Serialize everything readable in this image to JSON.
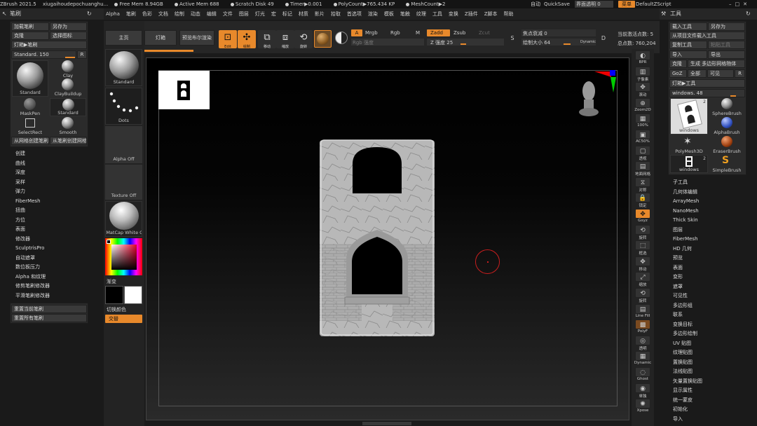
{
  "titlebar": {
    "app": "ZBrush 2021.5",
    "project": "xiugaihoudepochuanghu...",
    "stats": [
      "Free Mem 8.94GB",
      "Active Mem 688",
      "Scratch Disk 49",
      "Timer▶0.001",
      "PolyCount▶765.434 KP",
      "MeshCount▶2"
    ],
    "auto": "自动",
    "quicksave": "QuickSave",
    "transparency": "界面透明 0",
    "menu_btn": "菜单",
    "script": "DefaultZScript"
  },
  "menubar": [
    "Alpha",
    "笔刷",
    "色彩",
    "文档",
    "绘制",
    "动态",
    "编辑",
    "文件",
    "图层",
    "灯光",
    "宏",
    "标记",
    "材质",
    "影片",
    "拾取",
    "首选项",
    "渲染",
    "模板",
    "笔触",
    "纹理",
    "工具",
    "变换",
    "Z插件",
    "Z脚本",
    "帮助"
  ],
  "left": {
    "title": "笔刷",
    "buttons": [
      "加载笔刷",
      "另存为",
      "克隆",
      "选择图标"
    ],
    "lightbox": "灯箱▶笔刷",
    "standard_slider": "Standard. 150",
    "r": "R",
    "brushes": [
      "Standard",
      "Clay",
      "ClayBuildup",
      "MaskPen",
      "Standard",
      "SelectRect",
      "Smooth"
    ],
    "create_from_brush": "从网格创建笔刷",
    "create_from_stroke": "从笔刷创建网格",
    "menu": [
      "创建",
      "曲线",
      "深度",
      "采样",
      "弹力",
      "FiberMesh",
      "扭曲",
      "方位",
      "表面",
      "修改器",
      "SculptrisPro",
      "自动遮罩",
      "数位板压力",
      "Alpha 和纹理",
      "修剪笔刷修改器",
      "平滑笔刷修改器"
    ],
    "reset_current": "重置当前笔刷",
    "reset_all": "重置所有笔刷"
  },
  "shelf": {
    "standard": "Standard",
    "dots": "Dots",
    "alpha_off": "Alpha Off",
    "texture_off": "Texture Off",
    "matcap": "MatCap White C",
    "gradient": "渐变",
    "switch_color": "切换颜色",
    "alternate": "交替"
  },
  "top": {
    "home": "主页",
    "lightbox": "灯箱",
    "preview": "预览布尔渲染",
    "tools": [
      "Edit",
      "绘制",
      "移动",
      "缩放",
      "旋转"
    ],
    "a": "A",
    "mrgb": "Mrgb",
    "rgb": "Rgb",
    "m": "M",
    "zadd": "Zadd",
    "zsub": "Zsub",
    "zcut": "Zcut",
    "rgb_intensity": "Rgb 强度",
    "z_intensity": "Z 强度 25",
    "focal": "焦点衰减 0",
    "draw_size": "绘制大小 64",
    "dynamic": "Dynamic",
    "active_points": "当前激活点数: 5",
    "total_points": "总点数: 760,204"
  },
  "right_toolbar": [
    "BPR",
    "子像素",
    "滚动",
    "Zoom2D",
    "100%",
    "AC50%",
    "透视",
    "地面网格",
    "对称",
    "锁定",
    "Gxyz",
    "旋转",
    "框选",
    "移动",
    "缩放",
    "旋转",
    "Line Fill",
    "PolyF",
    "透明",
    "Dynamic",
    "Ghost",
    "单独",
    "Xpose"
  ],
  "tool": {
    "title": "工具",
    "load": "载入工具",
    "save_as": "另存为",
    "load_from_project": "从项目文件载入工具",
    "copy": "复制工具",
    "paste": "粘贴工具",
    "import": "导入",
    "export": "导出",
    "clone": "克隆",
    "make_polymesh": "生成 多边形网格物体",
    "goz": "GoZ",
    "all": "全部",
    "visible": "可见",
    "r": "R",
    "lightbox": "灯箱▶工具",
    "windows_slider": "windows. 48",
    "thumbs": [
      "windows",
      "SphereBrush",
      "AlphaBrush",
      "PolyMesh3D",
      "EraserBrush",
      "windows",
      "SimpleBrush"
    ],
    "count1": "2",
    "count2": "2",
    "menu": [
      "子工具",
      "几何体编辑",
      "ArrayMesh",
      "NanoMesh",
      "Thick Skin",
      "图层",
      "FiberMesh",
      "HD 几何",
      "预览",
      "表面",
      "变形",
      "遮罩",
      "可见性",
      "多边形组",
      "联系",
      "变换目标",
      "多边形绘制",
      "UV 贴图",
      "纹理贴图",
      "置换贴图",
      "法线贴图",
      "矢量置换贴图",
      "显示属性",
      "统一蒙皮",
      "初始化",
      "导入"
    ]
  },
  "colors": {
    "accent": "#e8892b",
    "panel": "#2b2b2b",
    "canvas": "#000000",
    "mesh": "#b5b5b5"
  }
}
